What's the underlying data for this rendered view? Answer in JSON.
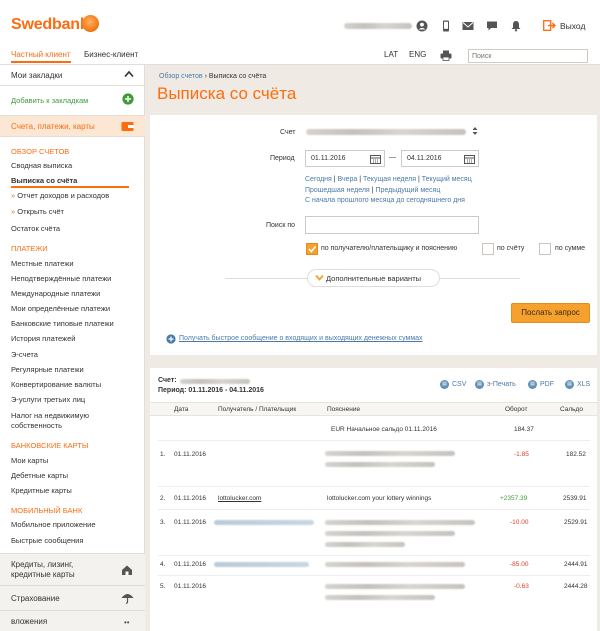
{
  "header": {
    "logo": "Swedbank",
    "exit_label": "Выход"
  },
  "nav": {
    "private": "Частный клиент",
    "business": "Бизнес-клиент",
    "lang_lat": "LAT",
    "lang_eng": "ENG",
    "search_placeholder": "Поиск"
  },
  "sidebar": {
    "bookmarks": "Мои закладки",
    "add_bookmark": "Добавить к закладкам",
    "accounts_section": "Счета, платежи, карты",
    "overview_head": "ОБЗОР СЧЕТОВ",
    "overview_items": [
      "Сводная выписка",
      "Выписка со счёта",
      "Отчет доходов и расходов",
      "Открыть счёт",
      "Остаток счёта"
    ],
    "payments_head": "ПЛАТЕЖИ",
    "payments_items": [
      "Местные платежи",
      "Неподтверждённые платежи",
      "Международные платежи",
      "Мои определённые платежи",
      "Банковские типовые платежи",
      "История платежей",
      "Э-счета",
      "Регулярные платежи",
      "Конвертирование валюты",
      "Э-услуги третьих лиц",
      "Налог на недвижимую",
      "собственность"
    ],
    "cards_head": "БАНКОВСКИЕ КАРТЫ",
    "cards_items": [
      "Мои карты",
      "Дебетные карты",
      "Кредитные карты"
    ],
    "mobile_head": "МОБИЛЬНЫЙ БАНК",
    "mobile_items": [
      "Мобильное приложение",
      "Быстрые сообщения"
    ],
    "credits": "Кредиты, лизинг, кредитные карты",
    "credits_l1": "Кредиты, лизинг,",
    "credits_l2": "кредитные карты",
    "insurance": "Страхование",
    "investments": "вложения"
  },
  "main": {
    "breadcrumb_home": "Обзор счетов",
    "breadcrumb_sep": "›",
    "breadcrumb_current": "Выписка со счёта",
    "title": "Выписка со счёта",
    "form": {
      "account_label": "Счет",
      "period_label": "Период",
      "date_from": "01.11.2016",
      "date_to": "04.11.2016",
      "period_dash": "—",
      "quick_links": [
        "Сегодня",
        "Вчера",
        "Текущая неделя",
        "Текущий месяц",
        "Прошедшая неделя",
        "Предыдущий месяц",
        "С начала прошлого месяца до сегодняшнего дня"
      ],
      "search_label": "Поиск по",
      "cb_payer": "по получателю/плательщику и пояснению",
      "cb_account": "по счёту",
      "cb_amount": "по сумме",
      "more_options": "Дополнительные варианты",
      "submit": "Послать запрос",
      "quick_message": "Получать быстрое сообщение о входящих и выходящих денежных суммах"
    },
    "result": {
      "account_label": "Счет:",
      "period": "Период: 01.11.2016 - 04.11.2016",
      "exports": [
        "CSV",
        "э-Печать",
        "PDF",
        "XLS"
      ],
      "columns": [
        "Дата",
        "Получатель / Плательщик",
        "Пояснение",
        "Оборот",
        "Сальдо"
      ],
      "opening": {
        "label": "EUR Начальное сальдо 01.11.2016",
        "amount": "184.37"
      },
      "rows": [
        {
          "n": "1.",
          "date": "01.11.2016",
          "payee": "",
          "desc": "",
          "turnover": "-1.85",
          "balance": "182.52"
        },
        {
          "n": "2.",
          "date": "01.11.2016",
          "payee": "lottolucker.com",
          "desc": "lottolucker.com your lottery winnings",
          "turnover": "+2357.39",
          "balance": "2539.91"
        },
        {
          "n": "3.",
          "date": "01.11.2016",
          "payee": "",
          "desc": "",
          "turnover": "-10.00",
          "balance": "2529.91"
        },
        {
          "n": "4.",
          "date": "01.11.2016",
          "payee": "",
          "desc": "",
          "turnover": "-85.00",
          "balance": "2444.91"
        },
        {
          "n": "5.",
          "date": "01.11.2016",
          "payee": "",
          "desc": "",
          "turnover": "-0.63",
          "balance": "2444.28"
        }
      ]
    }
  },
  "colors": {
    "brand": "#fd6c0f",
    "link": "#4a7aa8",
    "negative": "#e0402a",
    "positive": "#3e9b3a",
    "button": "#f6a02e"
  }
}
